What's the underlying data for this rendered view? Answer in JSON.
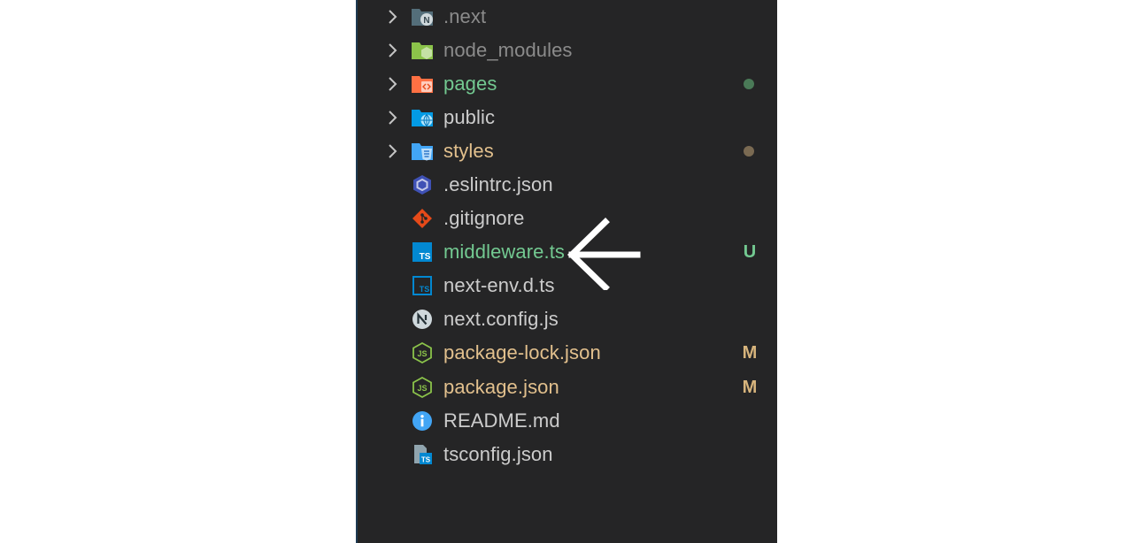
{
  "explorer": {
    "items": [
      {
        "label": ".next",
        "type": "folder",
        "icon": "next-folder-icon",
        "color": "#8b8b8b"
      },
      {
        "label": "node_modules",
        "type": "folder",
        "icon": "node-modules-folder-icon",
        "color": "#8b8b8b"
      },
      {
        "label": "pages",
        "type": "folder",
        "icon": "pages-folder-icon",
        "color": "#73c991",
        "status_dot": "#4a7a57"
      },
      {
        "label": "public",
        "type": "folder",
        "icon": "public-folder-icon",
        "color": "#cccccc"
      },
      {
        "label": "styles",
        "type": "folder",
        "icon": "styles-folder-icon",
        "color": "#e2c08d",
        "status_dot": "#7a6a52"
      },
      {
        "label": ".eslintrc.json",
        "type": "file",
        "icon": "eslint-icon",
        "color": "#cccccc"
      },
      {
        "label": ".gitignore",
        "type": "file",
        "icon": "git-icon",
        "color": "#cccccc"
      },
      {
        "label": "middleware.ts",
        "type": "file",
        "icon": "typescript-icon",
        "color": "#73c991",
        "badge": "U",
        "badge_color": "#73c991"
      },
      {
        "label": "next-env.d.ts",
        "type": "file",
        "icon": "typescript-def-icon",
        "color": "#cccccc"
      },
      {
        "label": "next.config.js",
        "type": "file",
        "icon": "nextjs-icon",
        "color": "#cccccc"
      },
      {
        "label": "package-lock.json",
        "type": "file",
        "icon": "nodejs-icon",
        "color": "#e2c08d",
        "badge": "M",
        "badge_color": "#d7b47c"
      },
      {
        "label": "package.json",
        "type": "file",
        "icon": "nodejs-icon",
        "color": "#e2c08d",
        "badge": "M",
        "badge_color": "#d7b47c"
      },
      {
        "label": "README.md",
        "type": "file",
        "icon": "info-icon",
        "color": "#cccccc"
      },
      {
        "label": "tsconfig.json",
        "type": "file",
        "icon": "tsconfig-icon",
        "color": "#cccccc"
      }
    ]
  },
  "annotation": {
    "icon": "left-arrow-icon",
    "color": "#ffffff",
    "points_to": "middleware.ts"
  }
}
